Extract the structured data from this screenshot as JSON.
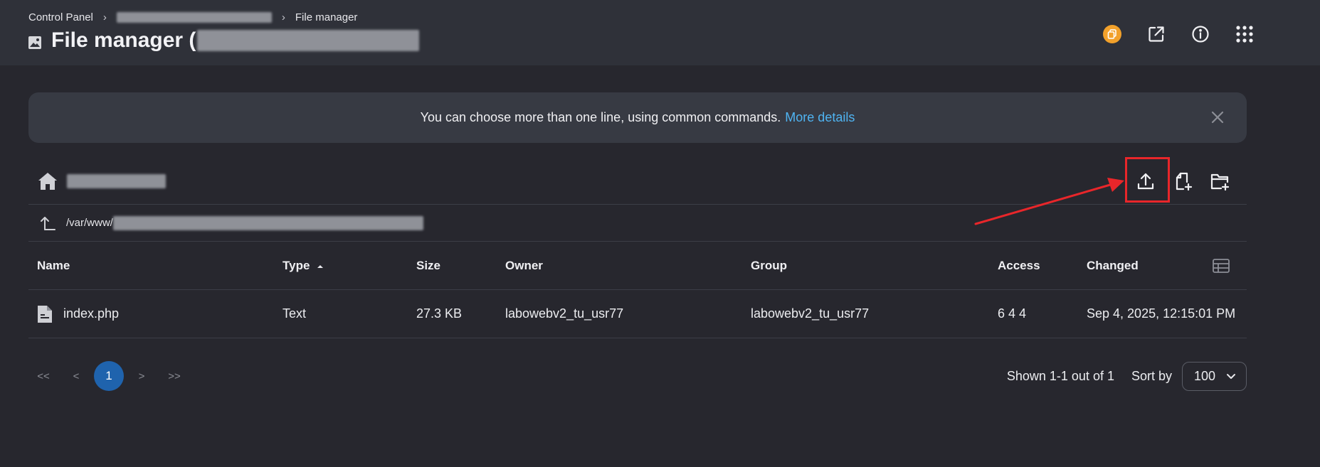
{
  "breadcrumb": {
    "root": "Control Panel",
    "current": "File manager"
  },
  "header": {
    "title": "File manager ("
  },
  "notice": {
    "text": "You can choose more than one line, using common commands.",
    "link": "More details"
  },
  "path": {
    "prefix": "/var/www/"
  },
  "table": {
    "columns": [
      "Name",
      "Type",
      "Size",
      "Owner",
      "Group",
      "Access",
      "Changed"
    ],
    "sort_column": "Type",
    "rows": [
      {
        "name": "index.php",
        "type": "Text",
        "size": "27.3 KB",
        "owner": "labowebv2_tu_usr77",
        "group": "labowebv2_tu_usr77",
        "access": "6 4 4",
        "changed": "Sep 4, 2025, 12:15:01 PM"
      }
    ]
  },
  "pagination": {
    "first": "<<",
    "prev": "<",
    "current": "1",
    "next": ">",
    "last": ">>"
  },
  "footer": {
    "shown": "Shown 1-1 out of 1",
    "sort_label": "Sort by",
    "sort_value": "100"
  },
  "colors": {
    "accent": "#4fb4f2",
    "page_active": "#1f63ad",
    "highlight": "#e8262a",
    "badge": "#f2a12b"
  }
}
